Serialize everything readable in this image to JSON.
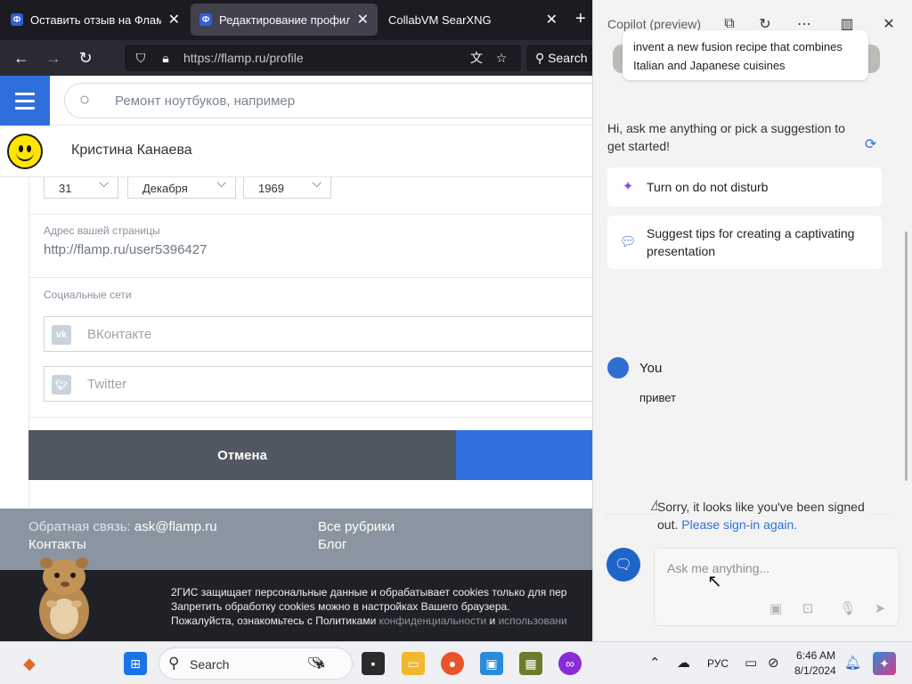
{
  "browser": {
    "tabs": [
      {
        "label": "Оставить отзыв на Флампе",
        "favicon": "Ф",
        "active": false
      },
      {
        "label": "Редактирование профиля",
        "favicon": "Ф",
        "active": true
      },
      {
        "label": "CollabVM SearXNG",
        "favicon": "",
        "active": false
      }
    ],
    "url": "https://flamp.ru/profile",
    "search_label": "Search"
  },
  "site": {
    "search_placeholder": "Ремонт ноутбуков, например",
    "user_name": "Кристина Канаева",
    "birth_day": "31",
    "birth_month": "Декабря",
    "birth_year": "1969",
    "page_url_label": "Адрес вашей страницы",
    "page_url_value": "http://flamp.ru/user5396427",
    "social_label": "Социальные сети",
    "vk_label": "ВКонтакте",
    "vk_icon": "vk",
    "twitter_label": "Twitter",
    "cancel_label": "Отмена",
    "footer": {
      "feedback_label": "Обратная связь:",
      "feedback_email": "ask@flamp.ru",
      "contacts": "Контакты",
      "all_rubrics": "Все рубрики",
      "blog": "Блог"
    },
    "cookie": {
      "line1": "2ГИС защищает персональные данные и обрабатывает cookies только для пер",
      "line2": "Запретить обработку cookies можно в настройках Вашего браузера.",
      "line3_text": "Пожалуйста, ознакомьтесь с Политиками ",
      "line3_link1": "конфиденциальности",
      "line3_and": " и ",
      "line3_link2": "использовани"
    }
  },
  "copilot": {
    "title": "Copilot (preview)",
    "suggestion_card": "invent a new fusion recipe that combines Italian and Japanese cuisines",
    "greeting": "Hi, ask me anything or pick a suggestion to get started!",
    "chips": [
      {
        "label": "Turn on do not disturb",
        "icon": "sparkle-icon"
      },
      {
        "label": "Suggest tips for creating a captivating presentation",
        "icon": "chat-bubbles-icon"
      }
    ],
    "you_label": "You",
    "user_message": "привет",
    "warning_text": "Sorry, it looks like you've been signed out.",
    "warning_link": "Please sign-in again.",
    "input_placeholder": "Ask me anything..."
  },
  "taskbar": {
    "search_label": "Search",
    "language": "РУС",
    "time": "6:46 AM",
    "date": "8/1/2024"
  },
  "colors": {
    "accent_blue": "#2f6fdc",
    "cancel_gray": "#525863",
    "footer_gray": "#8b95a1"
  }
}
